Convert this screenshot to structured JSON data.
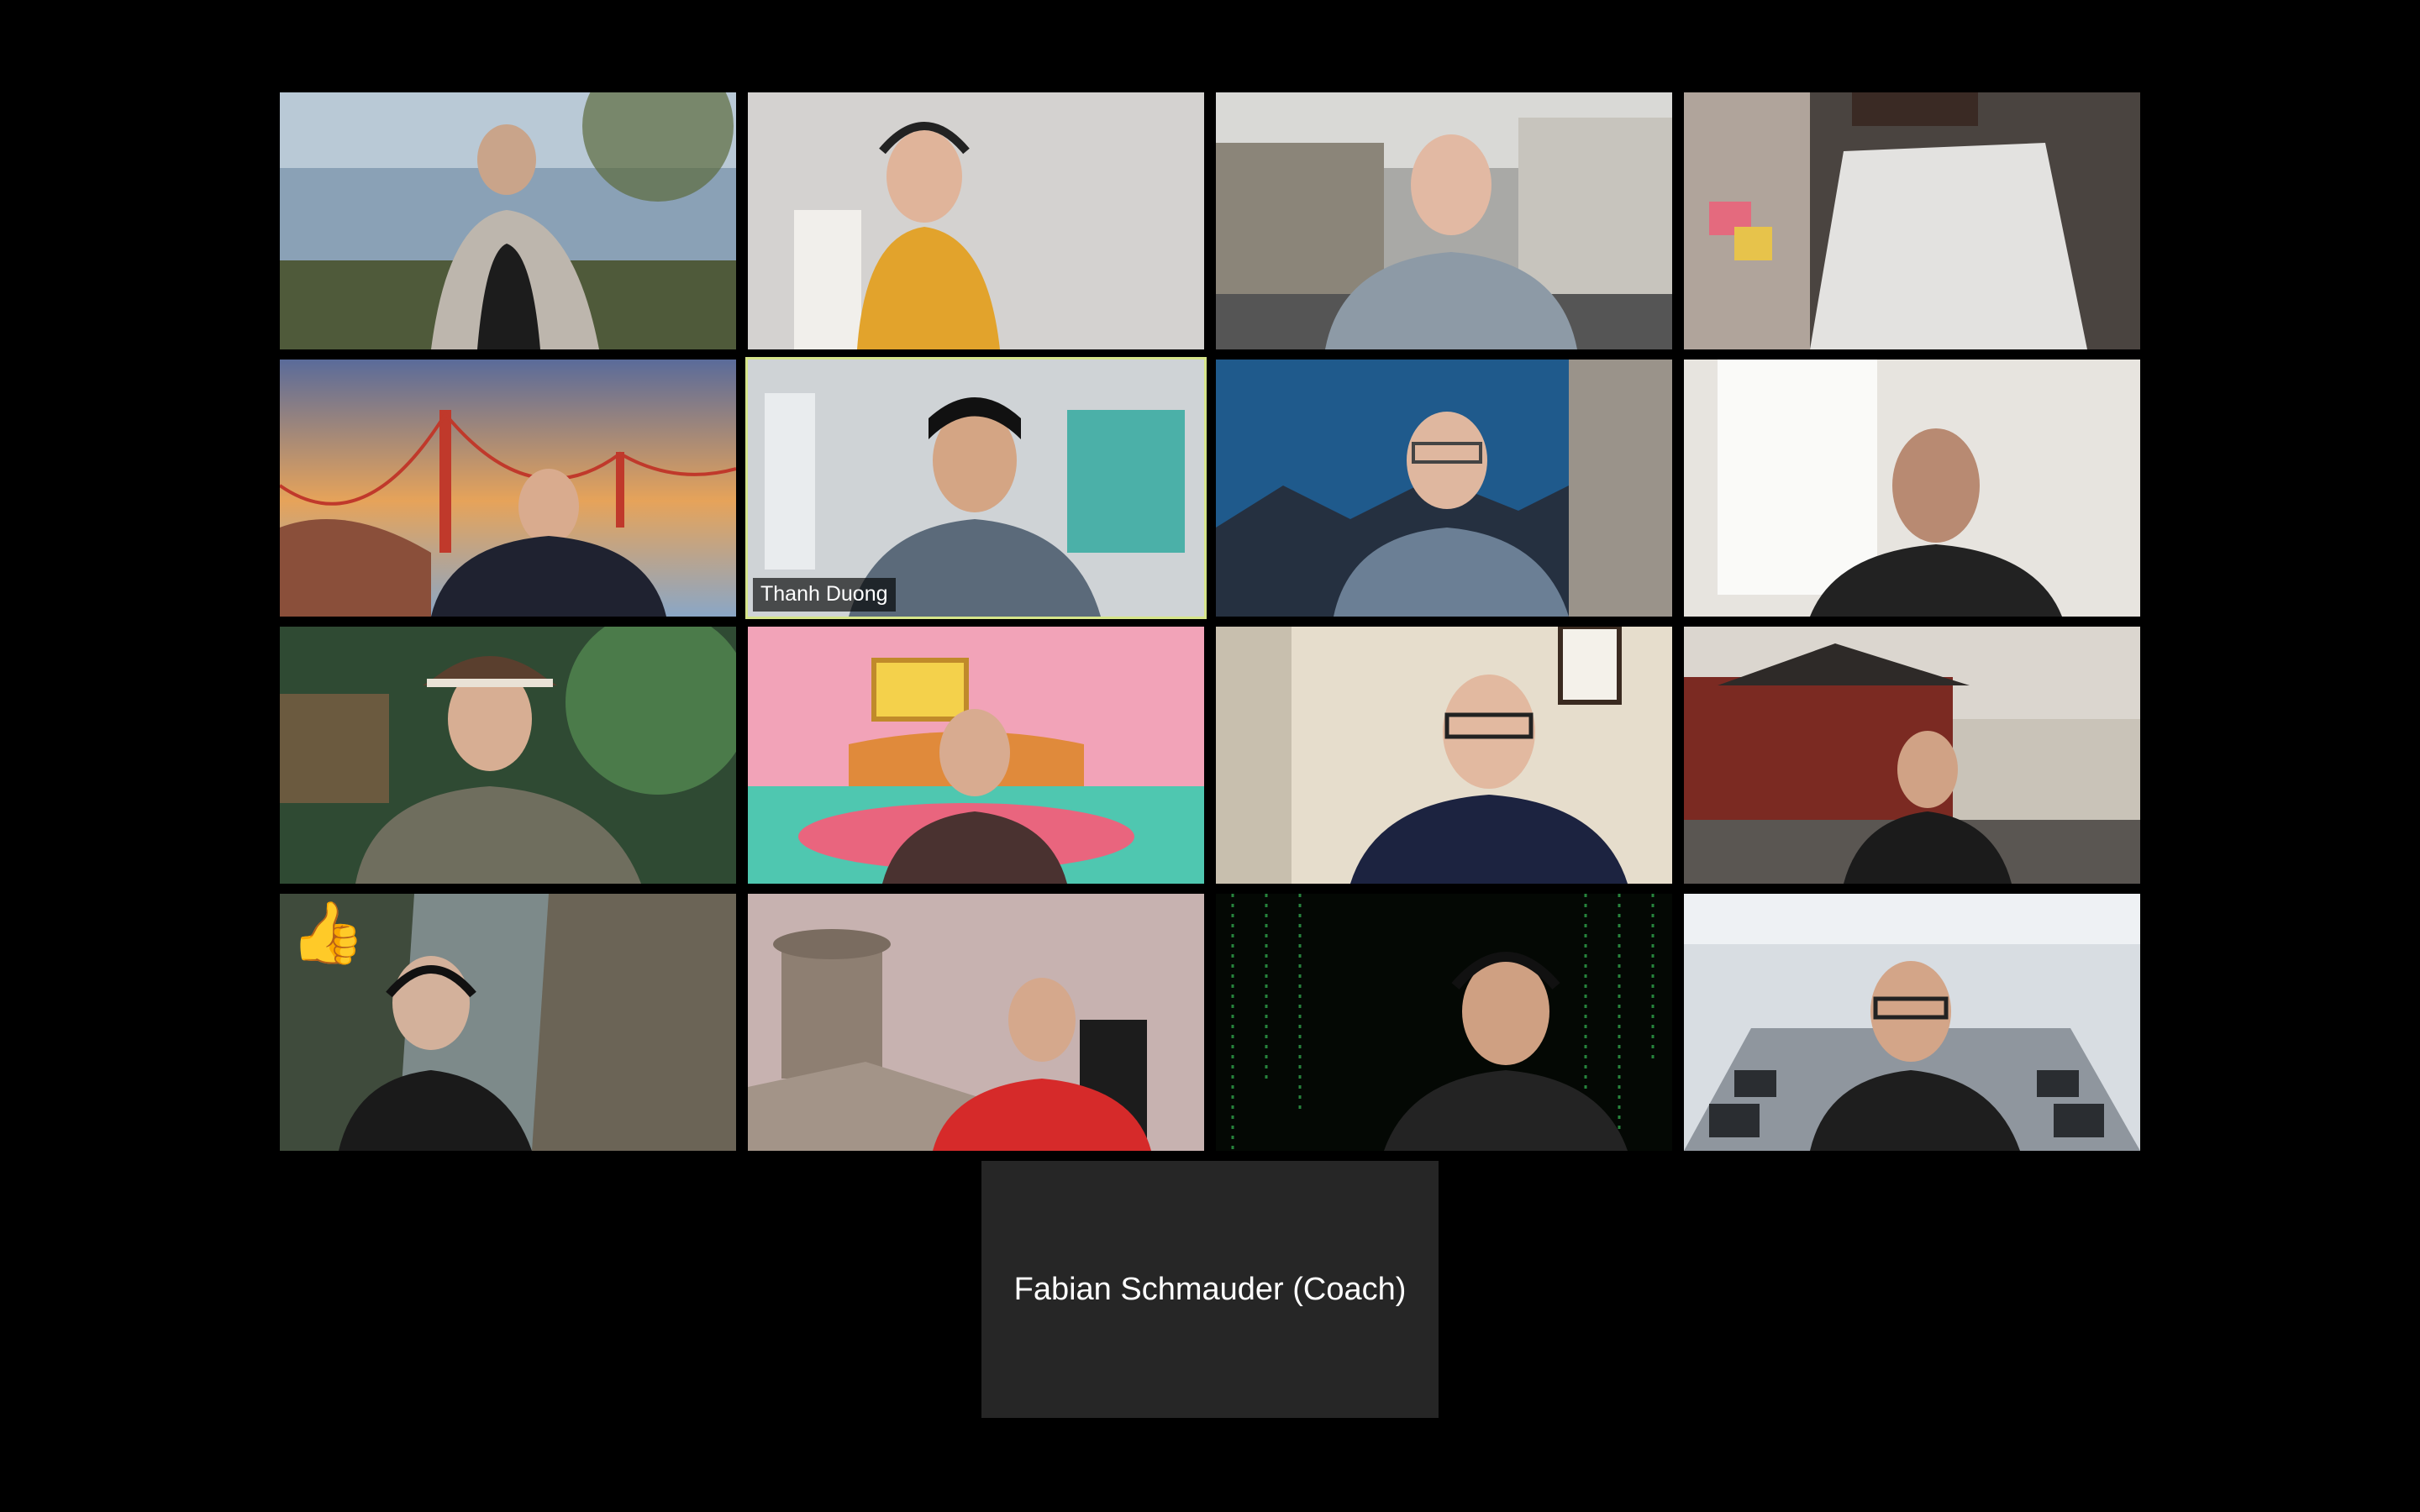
{
  "meeting": {
    "active_speaker_name": "Thanh Duong",
    "audio_only_participant_name": "Fabian Schmauder (Coach)",
    "reaction": "👍"
  },
  "participants": [
    {
      "background": "lake",
      "has_name_tag": false
    },
    {
      "background": "white-room",
      "has_name_tag": false
    },
    {
      "background": "city-square",
      "has_name_tag": false
    },
    {
      "background": "office-wall",
      "has_name_tag": false
    },
    {
      "background": "golden-gate-bridge",
      "has_name_tag": false
    },
    {
      "background": "room",
      "has_name_tag": true,
      "name": "Thanh Duong",
      "is_active_speaker": true
    },
    {
      "background": "mountains",
      "has_name_tag": false
    },
    {
      "background": "bright-room",
      "has_name_tag": false
    },
    {
      "background": "forest",
      "has_name_tag": false
    },
    {
      "background": "cartoon-living-room",
      "has_name_tag": false
    },
    {
      "background": "bookshelf-room",
      "has_name_tag": false
    },
    {
      "background": "temple",
      "has_name_tag": false
    },
    {
      "background": "fantasy-cliffs",
      "has_name_tag": false,
      "reaction": "👍"
    },
    {
      "background": "desert-palace",
      "has_name_tag": false
    },
    {
      "background": "matrix-code",
      "has_name_tag": false
    },
    {
      "background": "airplane-cabin",
      "has_name_tag": false
    }
  ],
  "colors": {
    "background": "#000000",
    "active_speaker_border": "#d6e58a",
    "audio_tile": "#262626"
  }
}
